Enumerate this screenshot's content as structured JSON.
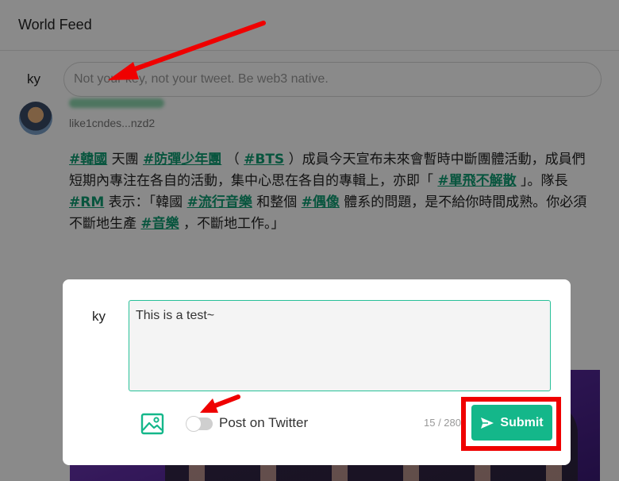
{
  "header": {
    "title": "World Feed"
  },
  "composer": {
    "avatar_text": "ky",
    "placeholder": "Not your key, not your tweet. Be web3 native."
  },
  "post": {
    "handle": "like1cndes...nzd2",
    "segments": [
      {
        "t": "#韓國",
        "tag": true
      },
      {
        "t": " 天團 ",
        "tag": false
      },
      {
        "t": "#防彈少年團",
        "tag": true
      },
      {
        "t": " （ ",
        "tag": false
      },
      {
        "t": "#BTS",
        "tag": true
      },
      {
        "t": " ）成員今天宣布未來會暫時中斷團體活動，成員們短期內專注在各自的活動，集中心思在各自的專輯上，亦即「 ",
        "tag": false
      },
      {
        "t": "#單飛不解散",
        "tag": true
      },
      {
        "t": " 」。隊長 ",
        "tag": false
      },
      {
        "t": "#RM",
        "tag": true
      },
      {
        "t": " 表示：「韓國 ",
        "tag": false
      },
      {
        "t": "#流行音樂",
        "tag": true
      },
      {
        "t": " 和整個 ",
        "tag": false
      },
      {
        "t": "#偶像",
        "tag": true
      },
      {
        "t": " 體系的問題，是不給你時間成熟。你必須不斷地生產 ",
        "tag": false
      },
      {
        "t": "#音樂",
        "tag": true
      },
      {
        "t": " ，不斷地工作。」",
        "tag": false
      }
    ]
  },
  "modal": {
    "avatar_text": "ky",
    "text_value": "This is a test~",
    "image_icon": "image-icon",
    "toggle_label": "Post on Twitter",
    "toggle_on": false,
    "char_count": "15 / 280",
    "submit_label": "Submit",
    "submit_icon": "send-icon"
  },
  "colors": {
    "accent": "#14b78a",
    "hashtag": "#0f9e74",
    "annotation": "#ef0000"
  }
}
